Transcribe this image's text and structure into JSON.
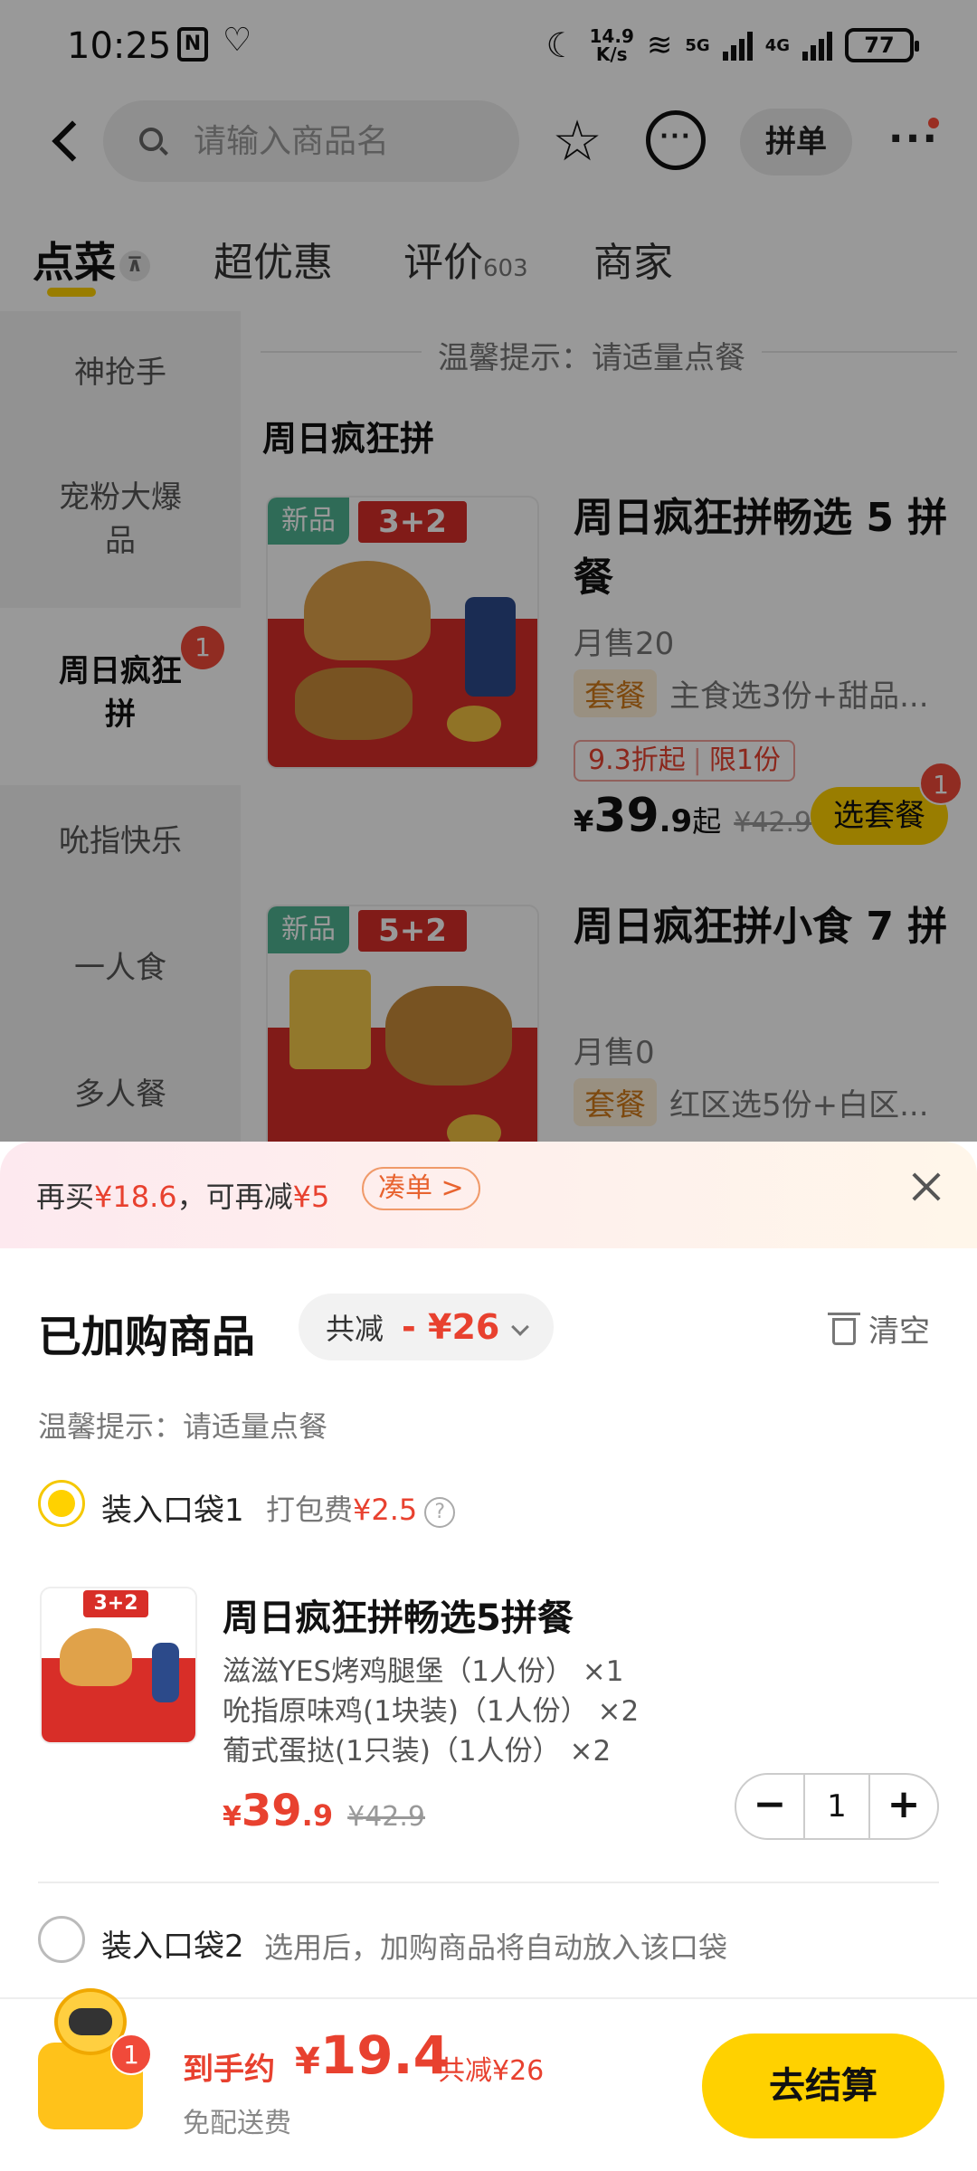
{
  "status_bar": {
    "time": "10:25",
    "nfc": "N",
    "speed_value": "14.9",
    "speed_unit": "K/s",
    "network_5g": "5G",
    "network_4g": "4G",
    "battery": "77"
  },
  "nav": {
    "search_placeholder": "请输入商品名",
    "pin_label": "拼单",
    "more_label": "···"
  },
  "tabs": [
    {
      "label": "点菜",
      "active": true
    },
    {
      "label": "超优惠"
    },
    {
      "label": "评价",
      "count": "603"
    },
    {
      "label": "商家"
    }
  ],
  "sidebar": {
    "items": [
      {
        "label": "神抢手"
      },
      {
        "label": "宠粉大爆品"
      },
      {
        "label": "周日疯狂拼",
        "badge": "1",
        "active": true
      },
      {
        "label": "吮指快乐"
      },
      {
        "label": "一人食"
      },
      {
        "label": "多人餐"
      }
    ]
  },
  "menu": {
    "tip": "温馨提示：请适量点餐",
    "section_title": "周日疯狂拼",
    "products": [
      {
        "image_badge": "新品",
        "image_combo": "3+2",
        "name": "周日疯狂拼畅选 5 拼餐",
        "sold": "月售20",
        "tag": "套餐",
        "desc": "主食选3份+甜品...",
        "promo_discount": "9.3折起",
        "promo_limit": "限1份",
        "price_symbol": "¥",
        "price_int": "39",
        "price_dec": ".9",
        "price_suffix": "起",
        "price_old": "¥42.9",
        "button": "选套餐",
        "button_badge": "1"
      },
      {
        "image_badge": "新品",
        "image_combo": "5+2",
        "name": "周日疯狂拼小食 7 拼",
        "sold": "月售0",
        "tag": "套餐",
        "desc": "红区选5份+白区..."
      }
    ]
  },
  "cart": {
    "banner_text_1": "再买",
    "banner_amount": "¥18.6",
    "banner_text_2": "，可再减",
    "banner_reduce": "¥5",
    "banner_button": "凑单 >",
    "title": "已加购商品",
    "discount_label": "共减",
    "discount_amount": "- ¥26",
    "clear_label": "清空",
    "tip": "温馨提示：请适量点餐",
    "bag1_label": "装入口袋1",
    "pack_fee_label": "打包费",
    "pack_fee_amount": "¥2.5",
    "help_icon": "?",
    "item": {
      "image_combo": "3+2",
      "name": "周日疯狂拼畅选5拼餐",
      "sub_items": [
        "滋滋YES烤鸡腿堡（1人份） ×1",
        "吮指原味鸡(1块装)（1人份） ×2",
        "葡式蛋挞(1只装)（1人份） ×2"
      ],
      "price_symbol": "¥",
      "price_int": "39",
      "price_dec": ".9",
      "price_old": "¥42.9",
      "quantity": "1",
      "minus": "−",
      "plus": "+"
    },
    "bag2_label": "装入口袋2",
    "bag2_hint": "选用后，加购商品将自动放入该口袋"
  },
  "footer": {
    "cart_badge": "1",
    "total_label": "到手约",
    "total_symbol": "¥",
    "total_amount": "19.4",
    "total_saved": "共减¥26",
    "delivery": "免配送费",
    "checkout": "去结算"
  },
  "colors": {
    "accent_yellow": "#ffd100",
    "price_red": "#e8412f",
    "badge_red": "#f04a3a",
    "new_green": "#4fb391"
  }
}
